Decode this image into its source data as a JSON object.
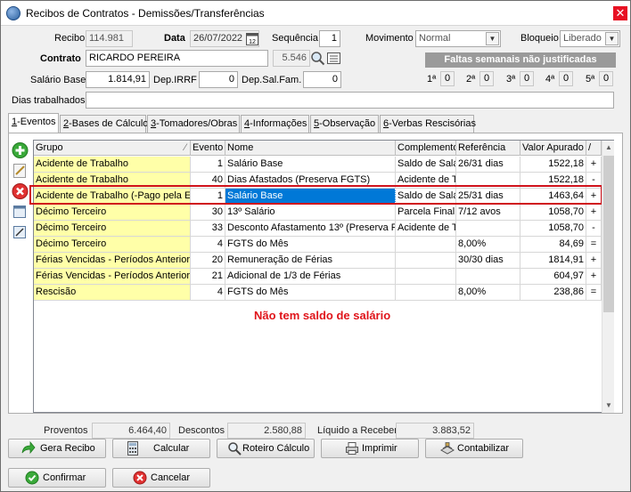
{
  "window": {
    "title": "Recibos de Contratos - Demissões/Transferências",
    "close_label": "✕"
  },
  "header": {
    "recibo_label": "Recibo",
    "recibo_value": "114.981",
    "data_label": "Data",
    "data_value": "26/07/2022",
    "sequencia_label": "Sequência",
    "sequencia_value": "1",
    "movimento_label": "Movimento",
    "movimento_value": "Normal",
    "bloqueio_label": "Bloqueio",
    "bloqueio_value": "Liberado",
    "contrato_label": "Contrato",
    "contrato_value": "RICARDO PEREIRA",
    "contrato_code": "5.546",
    "salario_label": "Salário Base",
    "salario_value": "1.814,91",
    "irrf_label": "Dep.IRRF",
    "irrf_value": "0",
    "salfam_label": "Dep.Sal.Fam.",
    "salfam_value": "0",
    "dias_label": "Dias trabalhados",
    "dias_value": ""
  },
  "faltas": {
    "title": "Faltas semanais não justificadas",
    "weeks": [
      {
        "label": "1ª",
        "value": "0"
      },
      {
        "label": "2ª",
        "value": "0"
      },
      {
        "label": "3ª",
        "value": "0"
      },
      {
        "label": "4ª",
        "value": "0"
      },
      {
        "label": "5ª",
        "value": "0"
      }
    ]
  },
  "tabs": [
    {
      "key": "1",
      "rest": "-Eventos"
    },
    {
      "key": "2",
      "rest": "-Bases de Cálculo"
    },
    {
      "key": "3",
      "rest": "-Tomadores/Obras"
    },
    {
      "key": "4",
      "rest": "-Informações"
    },
    {
      "key": "5",
      "rest": "-Observação"
    },
    {
      "key": "6",
      "rest": "-Verbas Rescisórias"
    }
  ],
  "grid": {
    "columns": [
      "Grupo",
      "Evento",
      "Nome",
      "Complemento",
      "Referência",
      "Valor Apurado",
      "/"
    ],
    "rows": [
      [
        "Acidente de Trabalho",
        "1",
        "Salário Base",
        "Saldo de Salá",
        "26/31 dias",
        "1522,18",
        "+"
      ],
      [
        "Acidente de Trabalho",
        "40",
        "Dias Afastados (Preserva FGTS)",
        "Acidente de T",
        "",
        "1522,18",
        "-"
      ],
      [
        "Acidente de Trabalho (-Pago pela Em",
        "1",
        "Salário Base",
        "Saldo de Salá",
        "25/31 dias",
        "1463,64",
        "+"
      ],
      [
        "Décimo Terceiro",
        "30",
        "13º Salário",
        "Parcela Final",
        "7/12 avos",
        "1058,70",
        "+"
      ],
      [
        "Décimo Terceiro",
        "33",
        "Desconto Afastamento 13º (Preserva F",
        "Acidente de T",
        "",
        "1058,70",
        "-"
      ],
      [
        "Décimo Terceiro",
        "4",
        "FGTS do Mês",
        "",
        "8,00%",
        "84,69",
        "="
      ],
      [
        "Férias Vencidas - Períodos Anteriore",
        "20",
        "Remuneração de Férias",
        "",
        "30/30 dias",
        "1814,91",
        "+"
      ],
      [
        "Férias Vencidas - Períodos Anteriore",
        "21",
        "Adicional de 1/3 de Férias",
        "",
        "",
        "604,97",
        "+"
      ],
      [
        "Rescisão",
        "4",
        "FGTS do Mês",
        "",
        "8,00%",
        "238,86",
        "="
      ]
    ],
    "note": "Não tem saldo de salário"
  },
  "totals": {
    "proventos_label": "Proventos",
    "proventos_value": "6.464,40",
    "descontos_label": "Descontos",
    "descontos_value": "2.580,88",
    "liquido_label": "Líquido a Receber",
    "liquido_value": "3.883,52"
  },
  "buttons": {
    "gera_recibo": "Gera Recibo",
    "calcular": "Calcular",
    "roteiro": "Roteiro Cálculo",
    "imprimir": "Imprimir",
    "contabilizar": "Contabilizar",
    "confirmar": "Confirmar",
    "cancelar": "Cancelar"
  },
  "colors": {
    "selection": "#0078d7",
    "group_highlight": "#ffffa8",
    "outline": "#d0121b",
    "note": "#e0151b"
  }
}
